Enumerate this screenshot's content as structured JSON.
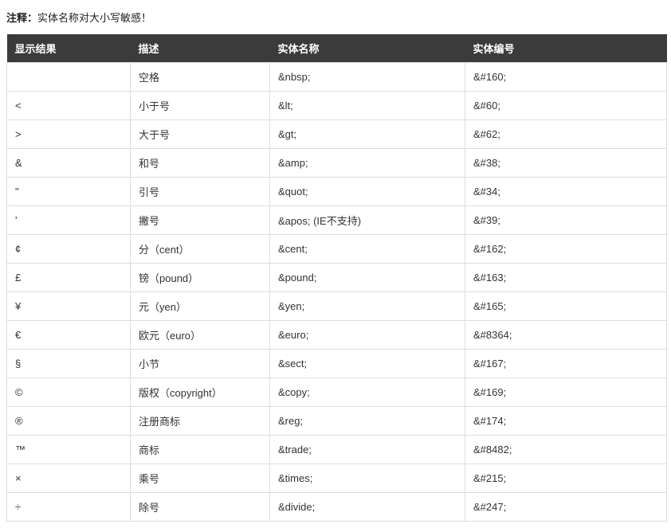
{
  "note_label": "注释：",
  "note_text": "实体名称对大小写敏感！",
  "table": {
    "headers": {
      "result": "显示结果",
      "desc": "描述",
      "name": "实体名称",
      "number": "实体编号"
    },
    "rows": [
      {
        "result": "",
        "desc": "空格",
        "name": "&nbsp;",
        "number": "&#160;"
      },
      {
        "result": "<",
        "desc": "小于号",
        "name": "&lt;",
        "number": "&#60;"
      },
      {
        "result": ">",
        "desc": "大于号",
        "name": "&gt;",
        "number": "&#62;"
      },
      {
        "result": "&",
        "desc": "和号",
        "name": "&amp;",
        "number": "&#38;"
      },
      {
        "result": "\"",
        "desc": "引号",
        "name": "&quot;",
        "number": "&#34;"
      },
      {
        "result": "'",
        "desc": "撇号",
        "name": "&apos; (IE不支持)",
        "number": "&#39;"
      },
      {
        "result": "¢",
        "desc": "分（cent）",
        "name": "&cent;",
        "number": "&#162;"
      },
      {
        "result": "£",
        "desc": "镑（pound）",
        "name": "&pound;",
        "number": "&#163;"
      },
      {
        "result": "¥",
        "desc": "元（yen）",
        "name": "&yen;",
        "number": "&#165;"
      },
      {
        "result": "€",
        "desc": "欧元（euro）",
        "name": "&euro;",
        "number": "&#8364;"
      },
      {
        "result": "§",
        "desc": "小节",
        "name": "&sect;",
        "number": "&#167;"
      },
      {
        "result": "©",
        "desc": "版权（copyright）",
        "name": "&copy;",
        "number": "&#169;"
      },
      {
        "result": "®",
        "desc": "注册商标",
        "name": "&reg;",
        "number": "&#174;"
      },
      {
        "result": "™",
        "desc": "商标",
        "name": "&trade;",
        "number": "&#8482;"
      },
      {
        "result": "×",
        "desc": "乘号",
        "name": "&times;",
        "number": "&#215;"
      },
      {
        "result": "÷",
        "desc": "除号",
        "name": "&divide;",
        "number": "&#247;"
      }
    ]
  }
}
